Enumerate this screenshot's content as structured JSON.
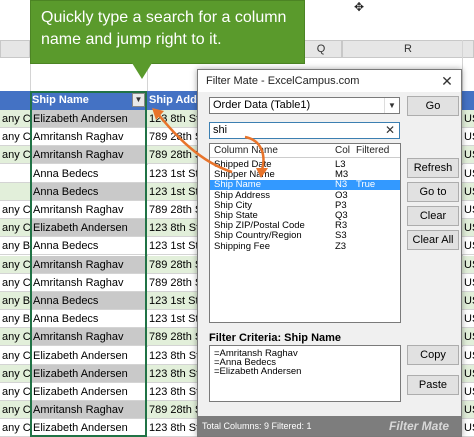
{
  "callout": {
    "text": "Quickly type a search for a column name and jump right to it."
  },
  "sheet": {
    "columns": [
      "Q",
      "R"
    ],
    "headers": [
      "Ship Name",
      "Ship Addre"
    ],
    "rows": [
      {
        "company": "any C",
        "name": "Elizabeth Andersen",
        "addr": "123 8th St"
      },
      {
        "company": "any C",
        "name": "Amritansh Raghav",
        "addr": "789 28th St"
      },
      {
        "company": "any C",
        "name": "Amritansh Raghav",
        "addr": "789 28th St"
      },
      {
        "company": "",
        "name": "Anna Bedecs",
        "addr": "123 1st Stre"
      },
      {
        "company": "",
        "name": "Anna Bedecs",
        "addr": "123 1st Stre"
      },
      {
        "company": "any C",
        "name": "Amritansh Raghav",
        "addr": "789 28th St"
      },
      {
        "company": "any C",
        "name": "Elizabeth Andersen",
        "addr": "123 8th Stre"
      },
      {
        "company": "any B",
        "name": "Anna Bedecs",
        "addr": "123 1st Stre"
      },
      {
        "company": "any C",
        "name": "Amritansh Raghav",
        "addr": "789 28th St"
      },
      {
        "company": "any C",
        "name": "Amritansh Raghav",
        "addr": "789 28th St"
      },
      {
        "company": "any B",
        "name": "Anna Bedecs",
        "addr": "123 1st Stre"
      },
      {
        "company": "any B",
        "name": "Anna Bedecs",
        "addr": "123 1st Stre"
      },
      {
        "company": "any C",
        "name": "Amritansh Raghav",
        "addr": "789 28th St"
      },
      {
        "company": "any C",
        "name": "Elizabeth Andersen",
        "addr": "123 8th Stre"
      },
      {
        "company": "any C",
        "name": "Elizabeth Andersen",
        "addr": "123 8th Stre"
      },
      {
        "company": "any C",
        "name": "Elizabeth Andersen",
        "addr": "123 8th Stre"
      },
      {
        "company": "any C",
        "name": "Amritansh Raghav",
        "addr": "789 28th St"
      },
      {
        "company": "any C",
        "name": "Elizabeth Andersen",
        "addr": "123 8th Stre"
      }
    ],
    "right_col_values": [
      "US",
      "US",
      "US",
      "US",
      "US",
      "US",
      "US",
      "US",
      "US",
      "US",
      "US",
      "US",
      "US",
      "US",
      "US",
      "US",
      "US",
      "US"
    ]
  },
  "dialog": {
    "title": "Filter Mate - ExcelCampus.com",
    "close_label": "✕",
    "table_select": "Order Data (Table1)",
    "search_value": "shi",
    "search_clear": "✕",
    "list_headers": {
      "name": "Column Name",
      "col": "Col",
      "filtered": "Filtered"
    },
    "list_items": [
      {
        "name": "Shipped Date",
        "col": "L3",
        "filtered": ""
      },
      {
        "name": "Shipper Name",
        "col": "M3",
        "filtered": ""
      },
      {
        "name": "Ship Name",
        "col": "N3",
        "filtered": "True"
      },
      {
        "name": "Ship Address",
        "col": "O3",
        "filtered": ""
      },
      {
        "name": "Ship City",
        "col": "P3",
        "filtered": ""
      },
      {
        "name": "Ship State",
        "col": "Q3",
        "filtered": ""
      },
      {
        "name": "Ship ZIP/Postal Code",
        "col": "R3",
        "filtered": ""
      },
      {
        "name": "Ship Country/Region",
        "col": "S3",
        "filtered": ""
      },
      {
        "name": "Shipping Fee",
        "col": "Z3",
        "filtered": ""
      }
    ],
    "buttons": {
      "go": "Go",
      "refresh": "Refresh",
      "go_to": "Go to",
      "clear": "Clear",
      "clear_all": "Clear All",
      "copy": "Copy",
      "paste": "Paste"
    },
    "criteria_label": "Filter Criteria: Ship Name",
    "criteria_items": [
      "=Amritansh Raghav",
      "=Anna Bedecs",
      "=Elizabeth Andersen"
    ],
    "status": "Total Columns: 9    Filtered: 1",
    "brand": "Filter Mate"
  },
  "colors": {
    "callout": "#5a9a2c",
    "header": "#4472c4",
    "selection": "#3399ff",
    "arrow": "#e8742b"
  }
}
